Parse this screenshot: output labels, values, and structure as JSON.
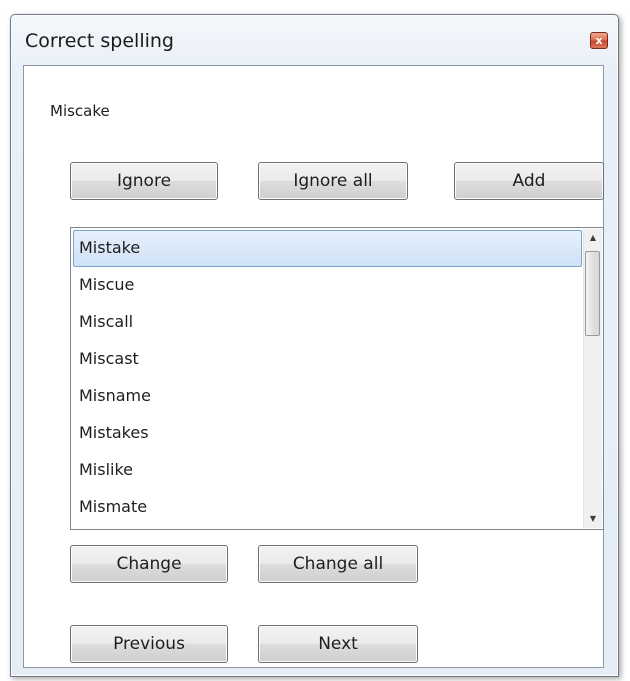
{
  "window": {
    "title": "Correct spelling",
    "close_symbol": "x"
  },
  "misspelled_word": "Miscake",
  "buttons": {
    "ignore": "Ignore",
    "ignore_all": "Ignore all",
    "add": "Add",
    "change": "Change",
    "change_all": "Change all",
    "previous": "Previous",
    "next": "Next"
  },
  "suggestions": {
    "selected_index": 0,
    "items": [
      "Mistake",
      "Miscue",
      "Miscall",
      "Miscast",
      "Misname",
      "Mistakes",
      "Mislike",
      "Mismate"
    ]
  },
  "scrollbar": {
    "up_arrow": "▲",
    "down_arrow": "▼"
  },
  "colors": {
    "selection_border": "#7da2ce",
    "selection_fill": "#cfe2f7",
    "close_button": "#c8462a"
  }
}
